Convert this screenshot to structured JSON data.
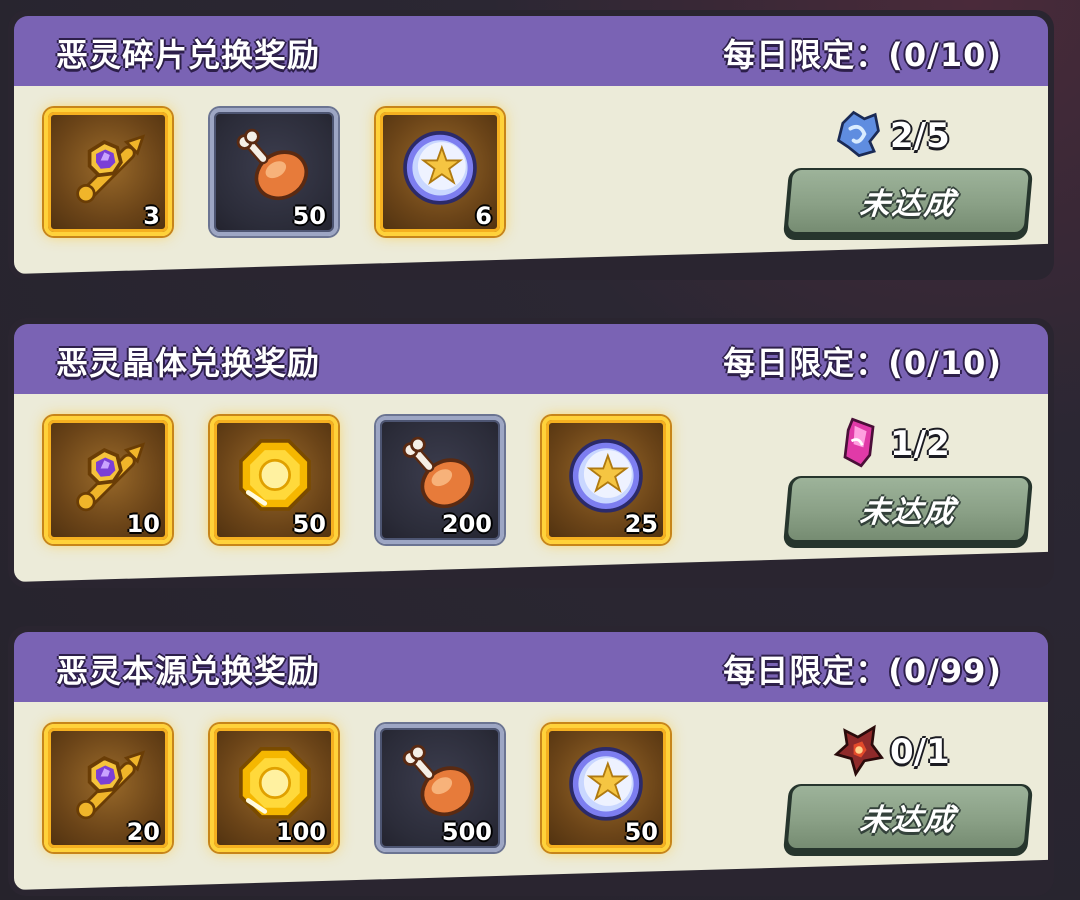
{
  "icons": {
    "medal": "purple-gem-key-icon",
    "drumstick": "meat-drumstick-icon",
    "coin": "star-coin-icon",
    "gold": "gold-gem-icon"
  },
  "colors": {
    "header": "#7a63b4",
    "body": "#ecebd9",
    "gold_frame": "#ffd23a",
    "dark_frame": "#9da6c4",
    "button": "#8aa086"
  },
  "cards": [
    {
      "title": "恶灵碎片兑换奖励",
      "limit": "每日限定：(0/10)",
      "rewards": [
        {
          "icon": "purple-gem-key-icon",
          "qty": "3",
          "frame": "gold"
        },
        {
          "icon": "meat-drumstick-icon",
          "qty": "50",
          "frame": "dark"
        },
        {
          "icon": "star-coin-icon",
          "qty": "6",
          "frame": "gold"
        }
      ],
      "currency_icon": "blue-shard-icon",
      "progress": "2/5",
      "status": "未达成"
    },
    {
      "title": "恶灵晶体兑换奖励",
      "limit": "每日限定：(0/10)",
      "rewards": [
        {
          "icon": "purple-gem-key-icon",
          "qty": "10",
          "frame": "gold"
        },
        {
          "icon": "gold-gem-icon",
          "qty": "50",
          "frame": "gold"
        },
        {
          "icon": "meat-drumstick-icon",
          "qty": "200",
          "frame": "dark"
        },
        {
          "icon": "star-coin-icon",
          "qty": "25",
          "frame": "gold"
        }
      ],
      "currency_icon": "pink-crystal-icon",
      "progress": "1/2",
      "status": "未达成"
    },
    {
      "title": "恶灵本源兑换奖励",
      "limit": "每日限定：(0/99)",
      "rewards": [
        {
          "icon": "purple-gem-key-icon",
          "qty": "20",
          "frame": "gold"
        },
        {
          "icon": "gold-gem-icon",
          "qty": "100",
          "frame": "gold"
        },
        {
          "icon": "meat-drumstick-icon",
          "qty": "500",
          "frame": "dark"
        },
        {
          "icon": "star-coin-icon",
          "qty": "50",
          "frame": "gold"
        }
      ],
      "currency_icon": "red-core-icon",
      "progress": "0/1",
      "status": "未达成"
    }
  ]
}
